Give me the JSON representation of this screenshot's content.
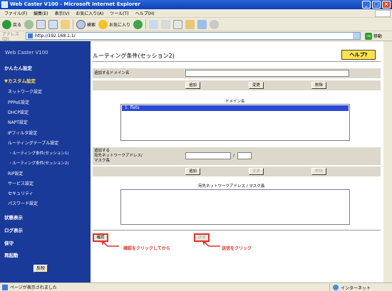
{
  "window": {
    "title": "Web Caster V100 - Microsoft Internet Explorer"
  },
  "menu": [
    "ファイル(F)",
    "編集(E)",
    "表示(V)",
    "お気に入り(A)",
    "ツール(T)",
    "ヘルプ(H)"
  ],
  "toolbar": {
    "back": "戻る",
    "search": "検索",
    "favorites": "お気に入り"
  },
  "address": {
    "label": "アドレス(D)",
    "url": "http://192.168.1.1/",
    "go": "移動"
  },
  "sidebar": {
    "brand": "Web Caster V100",
    "items": [
      "かんたん設定",
      "▼カスタム設定",
      "ネットワーク設定",
      "PPPoE設定",
      "DHCP設定",
      "NAPT設定",
      "IPフィルタ設定",
      "ルーティングテーブル設定",
      "・ルーティング条件(セッション1)",
      "・ルーティング条件(セッション2)",
      "RIP設定",
      "サービス設定",
      "セキュリティ",
      "パスワード設定",
      "状態表示",
      "ログ表示",
      "保守",
      "再起動"
    ],
    "apply": "反映"
  },
  "main": {
    "title": "ルーティング条件(セッション2)",
    "help": "ヘルプ?",
    "domain_label": "追加するドメイン名",
    "domain_value": "",
    "btn_add": "追加",
    "btn_change": "変更",
    "btn_delete": "削除",
    "domain_list_caption": "ドメイン名",
    "domain_list": [
      "1. flets"
    ],
    "net_label_1": "追加する",
    "net_label_2": "宛先ネットワークアドレス/",
    "net_label_3": "マスク長",
    "slash": "/",
    "net_list_caption": "宛先ネットワークアドレス / マスク長",
    "confirm": "確認",
    "send": "送信",
    "annot_confirm": "確認をクリックしてから",
    "annot_send": "送信をクリック"
  },
  "status": {
    "text": "ページが表示されました",
    "zone": "インターネット"
  },
  "colors": {
    "sidebar": "#1a3a9a",
    "accent_red": "#e0302a",
    "help_yellow": "#ffe24a",
    "selection": "#2a49d8"
  }
}
